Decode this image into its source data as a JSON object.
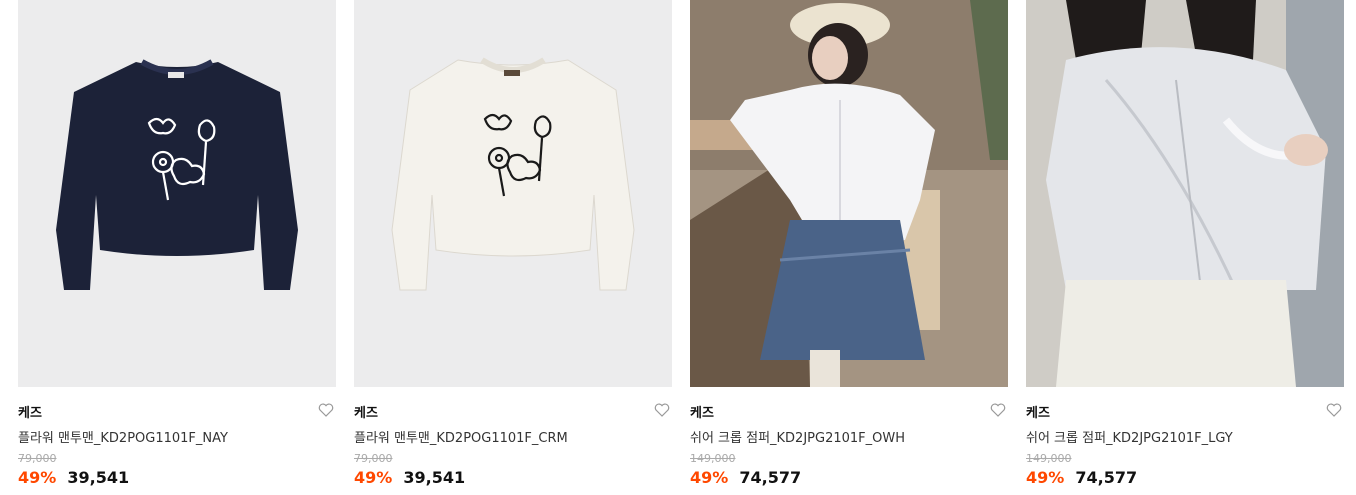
{
  "products": [
    {
      "brand": "케즈",
      "name": "플라워 맨투맨_KD2POG1101F_NAY",
      "original_price": "79,000",
      "discount": "49%",
      "price": "39,541",
      "image": "navy-sweatshirt-flower-print",
      "colors": {
        "garment": "#1c2238",
        "print": "#ffffff",
        "bg": "#ececed"
      }
    },
    {
      "brand": "케즈",
      "name": "플라워 맨투맨_KD2POG1101F_CRM",
      "original_price": "79,000",
      "discount": "49%",
      "price": "39,541",
      "image": "cream-sweatshirt-flower-print",
      "colors": {
        "garment": "#f4f2ec",
        "print": "#1a1a1a",
        "bg": "#ececed"
      }
    },
    {
      "brand": "케즈",
      "name": "쉬어 크롭 점퍼_KD2JPG2101F_OWH",
      "original_price": "149,000",
      "discount": "49%",
      "price": "74,577",
      "image": "model-white-jumper-denim-skirt"
    },
    {
      "brand": "케즈",
      "name": "쉬어 크롭 점퍼_KD2JPG2101F_LGY",
      "original_price": "149,000",
      "discount": "49%",
      "price": "74,577",
      "image": "model-grey-sheer-jumper"
    }
  ],
  "accent_color": "#ff4800",
  "wishlist_icon": "heart-outline-icon"
}
